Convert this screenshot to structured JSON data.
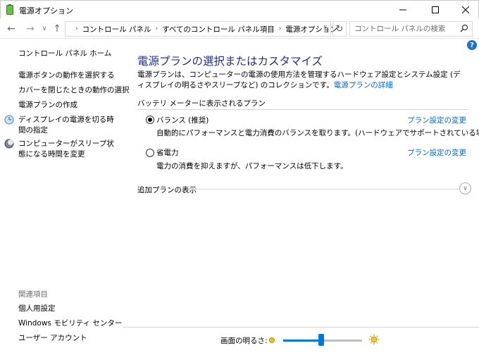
{
  "window": {
    "title": "電源オプション"
  },
  "nav": {
    "breadcrumbs": [
      "コントロール パネル",
      "すべてのコントロール パネル項目",
      "電源オプション"
    ],
    "search_placeholder": "コントロール パネルの検索"
  },
  "sidebar": {
    "home": "コントロール パネル ホーム",
    "links": [
      "電源ボタンの動作を選択する",
      "カバーを閉じたときの動作の選択",
      "電源プランの作成",
      "ディスプレイの電源を切る時間の指定",
      "コンピューターがスリープ状態になる時間を変更"
    ],
    "related_heading": "関連項目",
    "related": [
      "個人用設定",
      "Windows モビリティ センター",
      "ユーザー アカウント"
    ]
  },
  "main": {
    "title": "電源プランの選択またはカスタマイズ",
    "description": "電源プランは、コンピューターの電源の使用方法を管理するハードウェア設定とシステム設定 (ディスプレイの明るさやスリープなど) のコレクションです。",
    "details_link": "電源プランの詳細",
    "section_label": "バッテリ メーターに表示されるプラン",
    "plans": [
      {
        "name": "バランス (推奨)",
        "change": "プラン設定の変更",
        "desc": "自動的にパフォーマンスと電力消費のバランスを取ります。(ハードウェアでサポートされている場合)",
        "selected": true
      },
      {
        "name": "省電力",
        "change": "プラン設定の変更",
        "desc": "電力の消費を抑えますが、パフォーマンスは低下します。",
        "selected": false
      }
    ],
    "more_plans": "追加プランの表示"
  },
  "brightness": {
    "label": "画面の明るさ:",
    "level_fraction": 0.48
  },
  "colors": {
    "accent": "#0078d7",
    "link": "#0066cc",
    "title": "#1e3287"
  }
}
